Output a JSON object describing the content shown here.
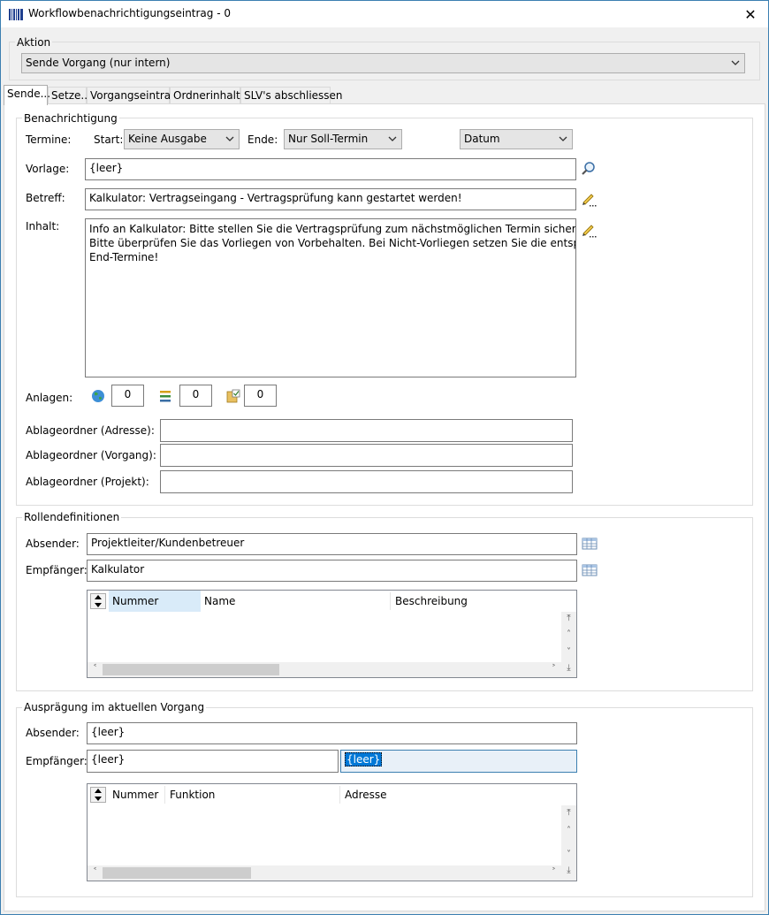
{
  "window": {
    "title": "Workflowbenachrichtigungseintrag - 0",
    "close_glyph": "✕"
  },
  "aktion": {
    "group_label": "Aktion",
    "value": "Sende Vorgang (nur intern)"
  },
  "tabs": [
    {
      "label": "Sende...",
      "active": true
    },
    {
      "label": "Setze...",
      "active": false
    },
    {
      "label": "Vorgangseintrag",
      "active": false
    },
    {
      "label": "Ordnerinhalte",
      "active": false
    },
    {
      "label": "SLV's abschliessen",
      "active": false
    }
  ],
  "benachrichtigung": {
    "group_label": "Benachrichtigung",
    "termine_label": "Termine:",
    "start_label": "Start:",
    "start_value": "Keine Ausgabe",
    "ende_label": "Ende:",
    "ende_value": "Nur Soll-Termin",
    "datum_value": "Datum",
    "vorlage_label": "Vorlage:",
    "vorlage_value": "{leer}",
    "betreff_label": "Betreff:",
    "betreff_value": "Kalkulator: Vertragseingang - Vertragsprüfung kann gestartet werden!",
    "inhalt_label": "Inhalt:",
    "inhalt_lines": [
      "Info an Kalkulator: Bitte stellen Sie die Vertragsprüfung zum nächstmöglichen Termin sicher!",
      "Bitte überprüfen Sie das Vorliegen von Vorbehalten. Bei Nicht-Vorliegen setzen Sie die entsprechenden",
      "End-Termine!"
    ],
    "anlagen_label": "Anlagen:",
    "anlagen_counts": [
      "0",
      "0",
      "0"
    ],
    "ablage_adresse_label": "Ablageordner (Adresse):",
    "ablage_vorgang_label": "Ablageordner (Vorgang):",
    "ablage_projekt_label": "Ablageordner (Projekt):",
    "ablage_adresse_value": "",
    "ablage_vorgang_value": "",
    "ablage_projekt_value": ""
  },
  "rollen": {
    "group_label": "Rollendefinitionen",
    "absender_label": "Absender:",
    "absender_value": "Projektleiter/Kundenbetreuer",
    "empfaenger_label": "Empfänger:",
    "empfaenger_value": "Kalkulator",
    "grid_columns": [
      "Nummer",
      "Name",
      "Beschreibung"
    ]
  },
  "auspraegung": {
    "group_label": "Ausprägung im aktuellen Vorgang",
    "absender_label": "Absender:",
    "absender_value": "{leer}",
    "empfaenger_label": "Empfänger:",
    "empfaenger_value1": "{leer}",
    "empfaenger_value2": "{leer}",
    "grid_columns": [
      "Nummer",
      "Funktion",
      "Adresse"
    ]
  },
  "icons": {
    "app": "barcode-icon",
    "search": "magnifier-icon",
    "edit": "pencil-icon",
    "table": "table-icon",
    "globe": "globe-icon",
    "list": "list-icon",
    "folder": "folder-check-icon"
  }
}
